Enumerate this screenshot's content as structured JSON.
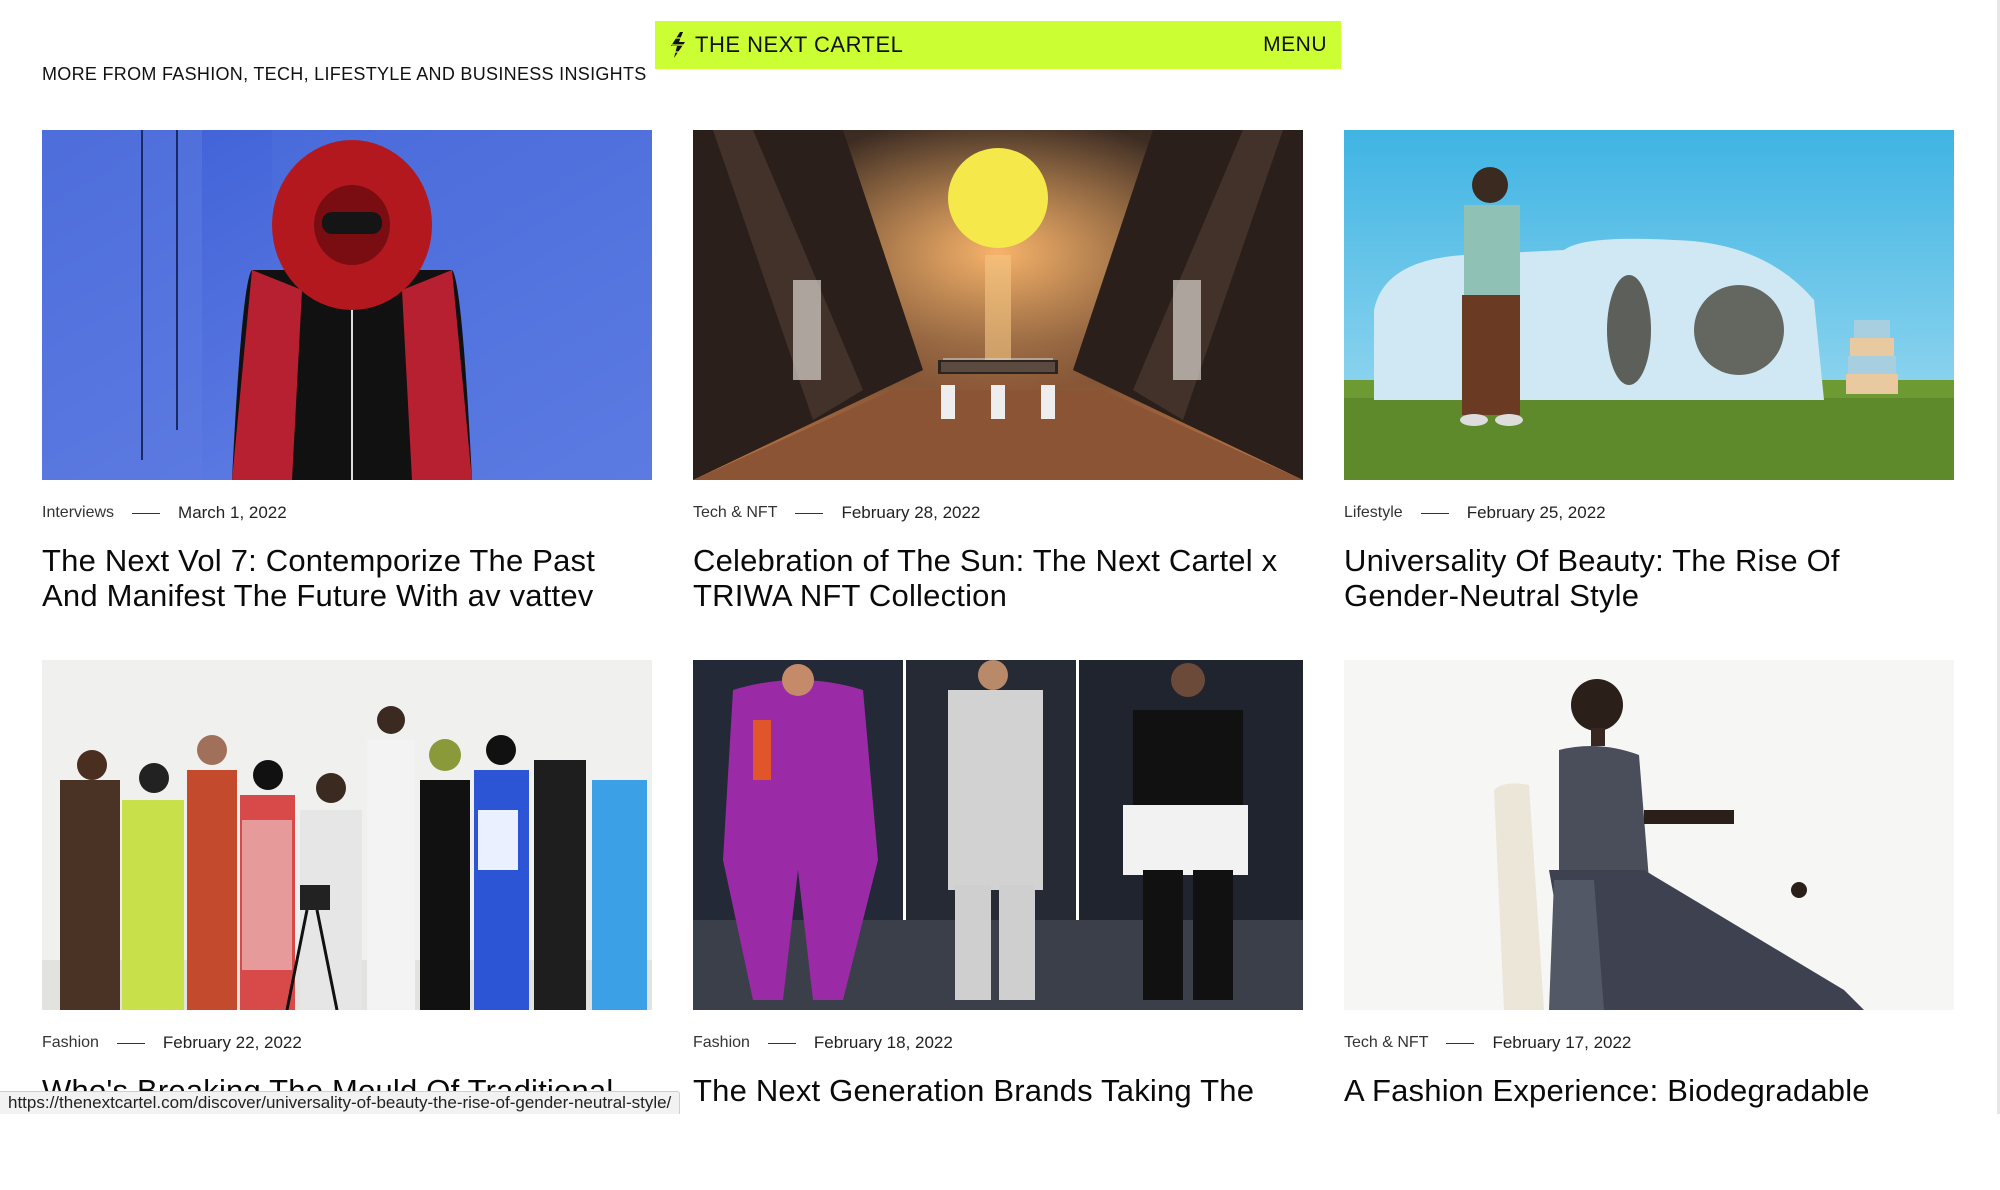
{
  "header": {
    "brand": "THE NEXT CARTEL",
    "menu_label": "MENU",
    "accent_color": "#ccff33",
    "logo_icon": "lightning-bolt-icon"
  },
  "section_heading": "MORE FROM FASHION, TECH, LIFESTYLE AND BUSINESS INSIGHTS",
  "articles": [
    {
      "category": "Interviews",
      "date": "March 1, 2022",
      "title": "The Next Vol 7: Contemporize The Past And Manifest The Future With av vattev",
      "image": "red-inflatable-hood-look"
    },
    {
      "category": "Tech & NFT",
      "date": "February 28, 2022",
      "title": "Celebration of The Sun: The Next Cartel x TRIWA NFT Collection",
      "image": "sun-virtual-gallery"
    },
    {
      "category": "Lifestyle",
      "date": "February 25, 2022",
      "title": "Universality Of Beauty: The Rise Of Gender-Neutral Style",
      "image": "man-before-white-house"
    },
    {
      "category": "Fashion",
      "date": "February 22, 2022",
      "title": "Who's Breaking The Mould Of Traditional",
      "image": "group-of-designers"
    },
    {
      "category": "Fashion",
      "date": "February 18, 2022",
      "title": "The Next Generation Brands Taking The",
      "image": "runway-triptych"
    },
    {
      "category": "Tech & NFT",
      "date": "February 17, 2022",
      "title": "A Fashion Experience: Biodegradable",
      "image": "woman-in-chair"
    }
  ],
  "status_url": "https://thenextcartel.com/discover/universality-of-beauty-the-rise-of-gender-neutral-style/"
}
